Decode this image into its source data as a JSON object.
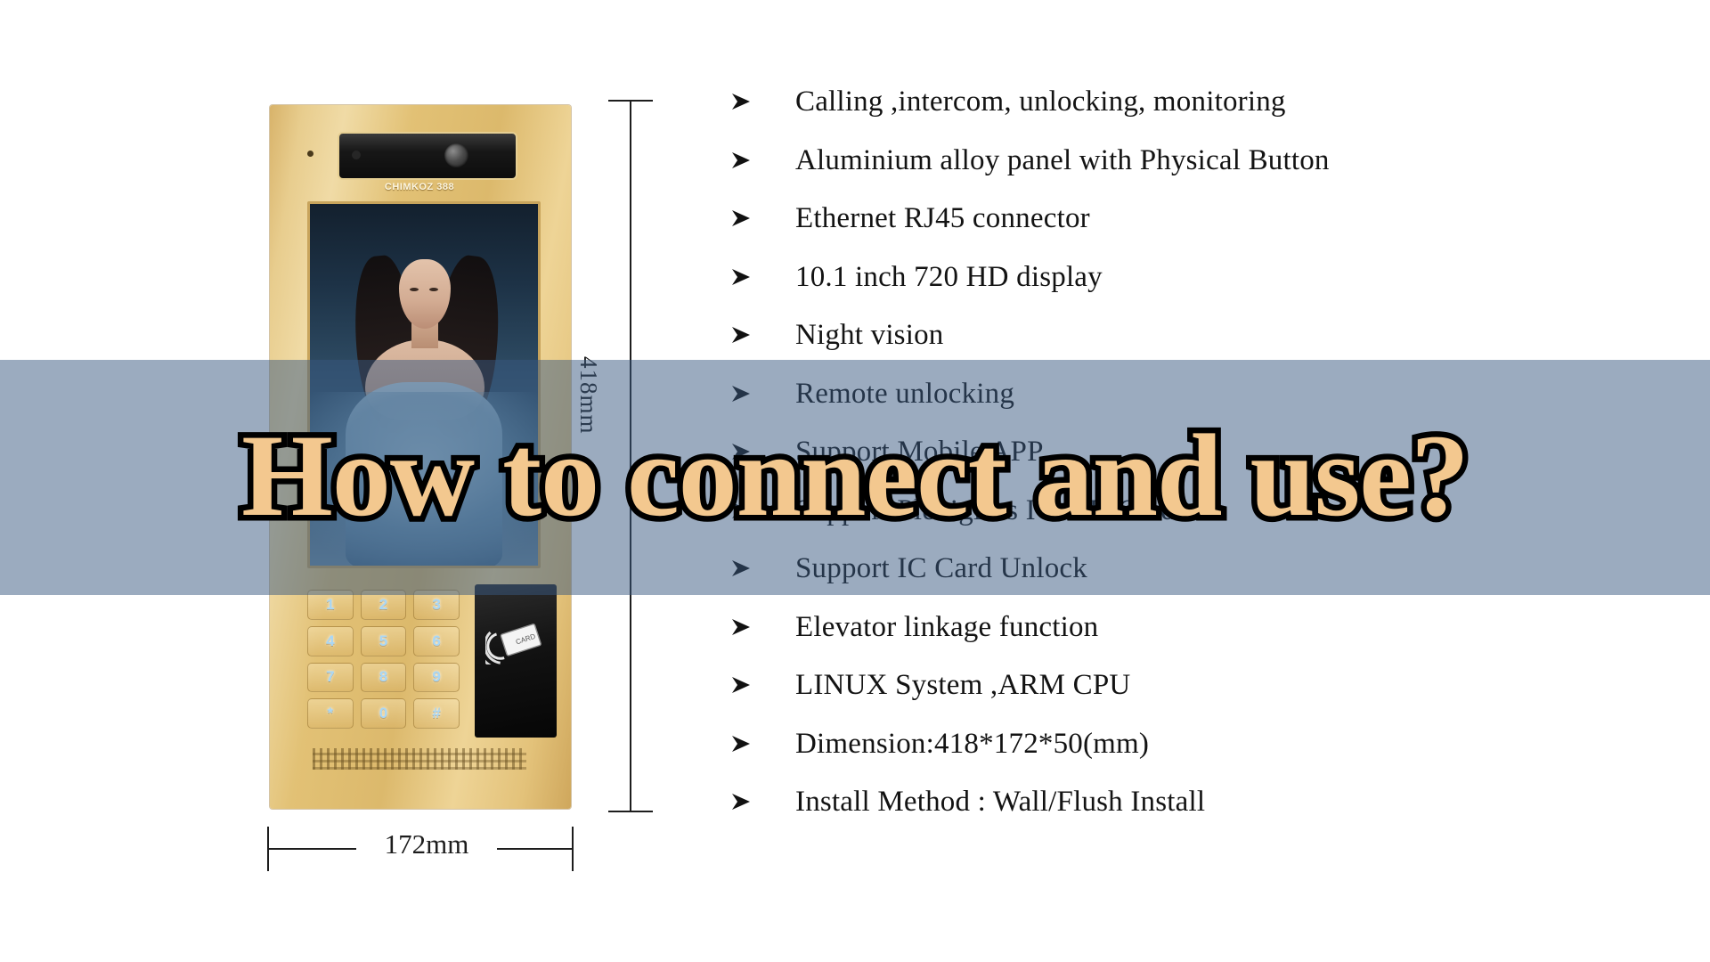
{
  "product": {
    "brand_logo_text": "CHIMKOZ 388",
    "screen_alt": "portrait-wallpaper",
    "keypad_keys": [
      "1",
      "2",
      "3",
      "4",
      "5",
      "6",
      "7",
      "8",
      "9",
      "*",
      "0",
      "#"
    ],
    "card_reader_label": "CARD"
  },
  "dimensions": {
    "height_label": "418mm",
    "width_label": "172mm"
  },
  "features": [
    {
      "text": "Calling ,intercom, unlocking, monitoring"
    },
    {
      "text": "Aluminium alloy panel with Physical Button"
    },
    {
      "text": "Ethernet RJ45 connector"
    },
    {
      "text": "10.1 inch 720 HD display"
    },
    {
      "text": "Night vision"
    },
    {
      "text": "Remote unlocking"
    },
    {
      "text": "Support Mobile APP"
    },
    {
      "text": "Support Plexiglass IC / ID Card"
    },
    {
      "text": "Support IC Card Unlock"
    },
    {
      "text": "Elevator linkage function"
    },
    {
      "text": "LINUX System ,ARM CPU"
    },
    {
      "text": "Dimension:418*172*50(mm)"
    },
    {
      "text": "Install Method : Wall/Flush Install"
    }
  ],
  "overlay": {
    "headline": "How to connect and use?",
    "band_color": "#38587f",
    "headline_fill": "#f3c88f",
    "headline_outline": "#000000"
  }
}
